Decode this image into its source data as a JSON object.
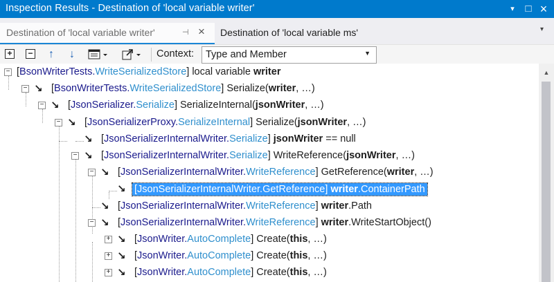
{
  "window": {
    "title": "Inspection Results - Destination of 'local variable writer'",
    "controls": {
      "dropdown": "▾",
      "maximize": "□",
      "close": "×"
    }
  },
  "tabs": {
    "active_label": "Destination of 'local variable writer'",
    "second_label": "Destination of 'local variable ms'",
    "pin_icon": "⊣",
    "close_icon": "×",
    "menu_icon": "▾"
  },
  "toolbar": {
    "expand_all": "+",
    "collapse_all": "−",
    "up": "↑",
    "down": "↓",
    "context_label": "Context:",
    "context_value": "Type and Member"
  },
  "tree": {
    "rows": [
      {
        "parts": [
          [
            "br",
            "["
          ],
          [
            "ty",
            "BsonWriterTests."
          ],
          [
            "me",
            "WriteSerializedStore"
          ],
          [
            "br",
            "]  local variable "
          ],
          [
            "bl",
            "writer"
          ]
        ]
      },
      {
        "parts": [
          [
            "br",
            "["
          ],
          [
            "ty",
            "BsonWriterTests."
          ],
          [
            "me",
            "WriteSerializedStore"
          ],
          [
            "br",
            "]  Serialize("
          ],
          [
            "bl",
            "writer"
          ],
          [
            "br",
            ", …)"
          ]
        ]
      },
      {
        "parts": [
          [
            "br",
            "["
          ],
          [
            "ty",
            "JsonSerializer."
          ],
          [
            "me",
            "Serialize"
          ],
          [
            "br",
            "]  SerializeInternal("
          ],
          [
            "bl",
            "jsonWriter"
          ],
          [
            "br",
            ", …)"
          ]
        ]
      },
      {
        "parts": [
          [
            "br",
            "["
          ],
          [
            "ty",
            "JsonSerializerProxy."
          ],
          [
            "me",
            "SerializeInternal"
          ],
          [
            "br",
            "]  Serialize("
          ],
          [
            "bl",
            "jsonWriter"
          ],
          [
            "br",
            ", …)"
          ]
        ]
      },
      {
        "parts": [
          [
            "br",
            "["
          ],
          [
            "ty",
            "JsonSerializerInternalWriter."
          ],
          [
            "me",
            "Serialize"
          ],
          [
            "br",
            "]  "
          ],
          [
            "bl",
            "jsonWriter"
          ],
          [
            "br",
            " == null"
          ]
        ]
      },
      {
        "parts": [
          [
            "br",
            "["
          ],
          [
            "ty",
            "JsonSerializerInternalWriter."
          ],
          [
            "me",
            "Serialize"
          ],
          [
            "br",
            "]  WriteReference("
          ],
          [
            "bl",
            "jsonWriter"
          ],
          [
            "br",
            ", …)"
          ]
        ]
      },
      {
        "parts": [
          [
            "br",
            "["
          ],
          [
            "ty",
            "JsonSerializerInternalWriter."
          ],
          [
            "me",
            "WriteReference"
          ],
          [
            "br",
            "]  GetReference("
          ],
          [
            "bl",
            "writer"
          ],
          [
            "br",
            ", …)"
          ]
        ]
      },
      {
        "parts": [
          [
            "br",
            "["
          ],
          [
            "ty",
            "JsonSerializerInternalWriter."
          ],
          [
            "me",
            "GetReference"
          ],
          [
            "br",
            "]  "
          ],
          [
            "bl",
            "writer"
          ],
          [
            "br",
            ".ContainerPath"
          ]
        ]
      },
      {
        "parts": [
          [
            "br",
            "["
          ],
          [
            "ty",
            "JsonSerializerInternalWriter."
          ],
          [
            "me",
            "WriteReference"
          ],
          [
            "br",
            "]  "
          ],
          [
            "bl",
            "writer"
          ],
          [
            "br",
            ".Path"
          ]
        ]
      },
      {
        "parts": [
          [
            "br",
            "["
          ],
          [
            "ty",
            "JsonSerializerInternalWriter."
          ],
          [
            "me",
            "WriteReference"
          ],
          [
            "br",
            "]  "
          ],
          [
            "bl",
            "writer"
          ],
          [
            "br",
            ".WriteStartObject()"
          ]
        ]
      },
      {
        "parts": [
          [
            "br",
            "["
          ],
          [
            "ty",
            "JsonWriter."
          ],
          [
            "me",
            "AutoComplete"
          ],
          [
            "br",
            "]  Create("
          ],
          [
            "bl",
            "this"
          ],
          [
            "br",
            ", …)"
          ]
        ]
      },
      {
        "parts": [
          [
            "br",
            "["
          ],
          [
            "ty",
            "JsonWriter."
          ],
          [
            "me",
            "AutoComplete"
          ],
          [
            "br",
            "]  Create("
          ],
          [
            "bl",
            "this"
          ],
          [
            "br",
            ", …)"
          ]
        ]
      },
      {
        "parts": [
          [
            "br",
            "["
          ],
          [
            "ty",
            "JsonWriter."
          ],
          [
            "me",
            "AutoComplete"
          ],
          [
            "br",
            "]  Create("
          ],
          [
            "bl",
            "this"
          ],
          [
            "br",
            ", …)"
          ]
        ]
      }
    ]
  },
  "scrollbar": {
    "up_icon": "▲"
  }
}
